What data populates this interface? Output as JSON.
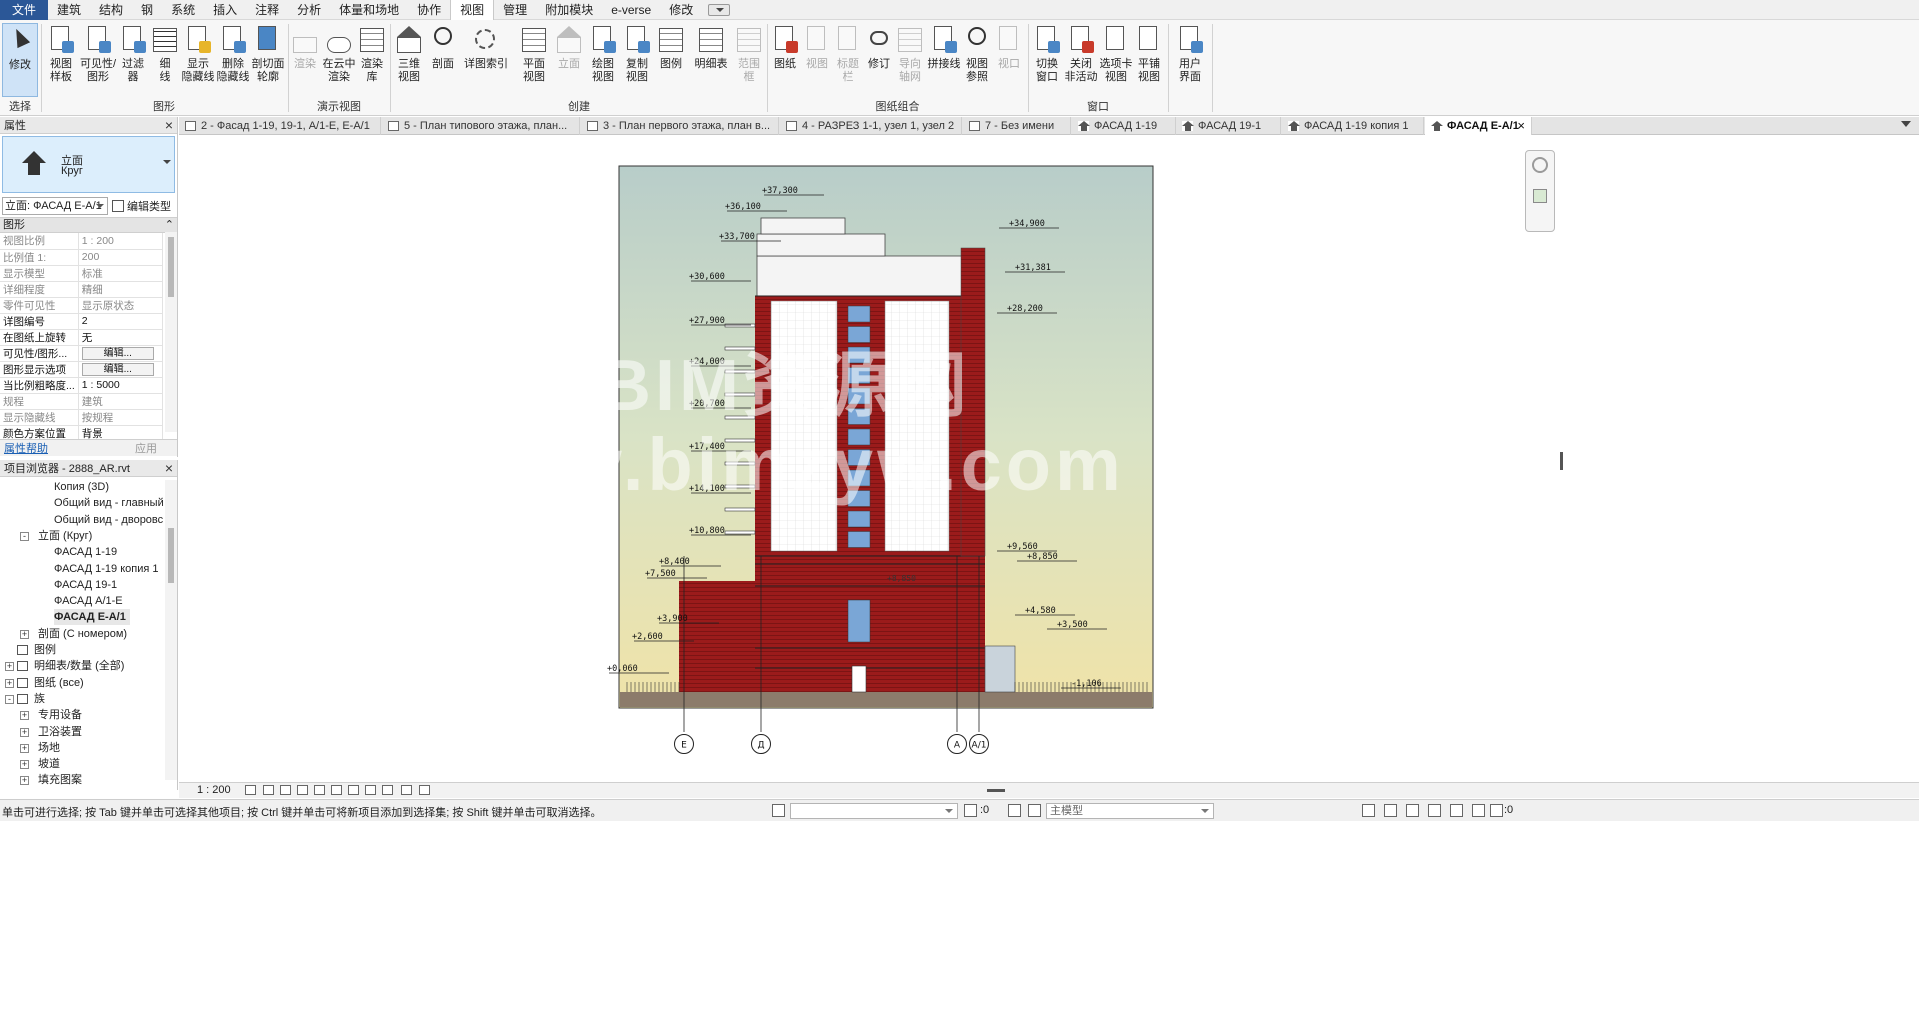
{
  "menu": {
    "items": [
      "文件",
      "建筑",
      "结构",
      "钢",
      "系统",
      "插入",
      "注释",
      "分析",
      "体量和场地",
      "协作",
      "视图",
      "管理",
      "附加模块",
      "e-verse",
      "修改"
    ],
    "active": "视图"
  },
  "ribbon": {
    "modify": "修改",
    "select": "选择",
    "buttons": [
      {
        "label": "视图\n样板"
      },
      {
        "label": "可见性/\n图形"
      },
      {
        "label": "过滤器"
      },
      {
        "label": "细\n线"
      },
      {
        "label": "显示\n隐藏线"
      },
      {
        "label": "删除\n隐藏线"
      },
      {
        "label": "剖切面\n轮廓"
      },
      {
        "label": "渲染"
      },
      {
        "label": "在云中\n渲染"
      },
      {
        "label": "渲染\n库"
      },
      {
        "label": "三维\n视图"
      },
      {
        "label": "剖面"
      },
      {
        "label": "详图索引"
      },
      {
        "label": "平面\n视图"
      },
      {
        "label": "立面"
      },
      {
        "label": "绘图\n视图"
      },
      {
        "label": "复制\n视图"
      },
      {
        "label": "图例"
      },
      {
        "label": "明细表"
      },
      {
        "label": "范围\n框"
      },
      {
        "label": "图纸"
      },
      {
        "label": "视图"
      },
      {
        "label": "标题\n栏"
      },
      {
        "label": "修订"
      },
      {
        "label": "导向\n轴网"
      },
      {
        "label": "拼接线"
      },
      {
        "label": "视图\n参照"
      },
      {
        "label": "视口"
      },
      {
        "label": "切换\n窗口"
      },
      {
        "label": "关闭\n非活动"
      },
      {
        "label": "选项卡\n视图"
      },
      {
        "label": "平铺\n视图"
      },
      {
        "label": "用户\n界面"
      }
    ],
    "panels": [
      "图形",
      "演示视图",
      "创建",
      "图纸组合",
      "窗口"
    ]
  },
  "properties": {
    "title": "属性",
    "type_name": "立面",
    "type_sub": "Круг",
    "selector": "立面: ФАСАД Е-А/1",
    "edit_type": "编辑类型",
    "group": "图形",
    "rows": [
      {
        "name": "视图比例",
        "value": "1 : 200",
        "enabled": false
      },
      {
        "name": "比例值 1:",
        "value": "200",
        "enabled": false
      },
      {
        "name": "显示模型",
        "value": "标准",
        "enabled": false
      },
      {
        "name": "详细程度",
        "value": "精细",
        "enabled": false
      },
      {
        "name": "零件可见性",
        "value": "显示原状态",
        "enabled": false
      },
      {
        "name": "详图编号",
        "value": "2",
        "enabled": true
      },
      {
        "name": "在图纸上旋转",
        "value": "无",
        "enabled": true
      },
      {
        "name": "可见性/图形...",
        "value": "编辑...",
        "enabled": true,
        "button": true
      },
      {
        "name": "图形显示选项",
        "value": "编辑...",
        "enabled": true,
        "button": true
      },
      {
        "name": "当比例粗略度...",
        "value": "1 : 5000",
        "enabled": true
      },
      {
        "name": "规程",
        "value": "建筑",
        "enabled": false
      },
      {
        "name": "显示隐藏线",
        "value": "按规程",
        "enabled": false
      },
      {
        "name": "颜色方案位置",
        "value": "背景",
        "enabled": true
      }
    ],
    "help": "属性帮助",
    "apply": "应用"
  },
  "browser": {
    "title": "项目浏览器 - 2888_AR.rvt",
    "items": [
      {
        "label": "Копия (3D)"
      },
      {
        "label": "Общий вид - главный"
      },
      {
        "label": "Общий вид - дворовс"
      },
      {
        "label": "立面 (Круг)"
      },
      {
        "label": "ФАСАД 1-19"
      },
      {
        "label": "ФАСАД 1-19 копия 1"
      },
      {
        "label": "ФАСАД 19-1"
      },
      {
        "label": "ФАСАД А/1-Е"
      },
      {
        "label": "ФАСАД Е-А/1"
      },
      {
        "label": "剖面 (С номером)"
      },
      {
        "label": "图例"
      },
      {
        "label": "明细表/数量 (全部)"
      },
      {
        "label": "图纸 (все)"
      },
      {
        "label": "族"
      },
      {
        "label": "专用设备"
      },
      {
        "label": "卫浴装置"
      },
      {
        "label": "场地"
      },
      {
        "label": "坡道"
      },
      {
        "label": "填充图案"
      }
    ]
  },
  "tabs": [
    {
      "label": "2 - Фасад 1-19, 19-1, А/1-Е, Е-А/1"
    },
    {
      "label": "5 - План типового этажа, план..."
    },
    {
      "label": "3 - План первого этажа, план в..."
    },
    {
      "label": "4 - РАЗРЕЗ 1-1, узел 1, узел 2"
    },
    {
      "label": "7 - Без имени"
    },
    {
      "label": "ФАСАД 1-19"
    },
    {
      "label": "ФАСАД 19-1"
    },
    {
      "label": "ФАСАД 1-19 копия 1"
    },
    {
      "label": "ФАСАД Е-А/1"
    }
  ],
  "drawing": {
    "elevations_left": [
      "+37,300",
      "+36,100",
      "+33,700",
      "+30,600",
      "+27,900",
      "+24,000",
      "+20,700",
      "+17,400",
      "+14,100",
      "+10,800",
      "+8,400",
      "+7,500",
      "+3,900",
      "+2,600",
      "+0,060"
    ],
    "elevations_right": [
      "+34,900",
      "+31,381",
      "+28,200",
      "+9,560",
      "+8,850",
      "+4,580",
      "+3,500",
      "-1,106"
    ],
    "mid_label": "+8,850",
    "grid_labels": [
      "Е",
      "Д",
      "А",
      "А/1"
    ],
    "watermark_line1": "BIM资源网",
    "watermark_line2": "www.bimzyw.com"
  },
  "viewbar": {
    "scale": "1 : 200"
  },
  "status": {
    "text": "单击可进行选择; 按 Tab 键并单击可选择其他项目; 按 Ctrl 键并单击可将新项目添加到选择集; 按 Shift 键并单击可取消选择。",
    "workset_count": ":0",
    "model": "主模型",
    "filter_count": ":0"
  }
}
